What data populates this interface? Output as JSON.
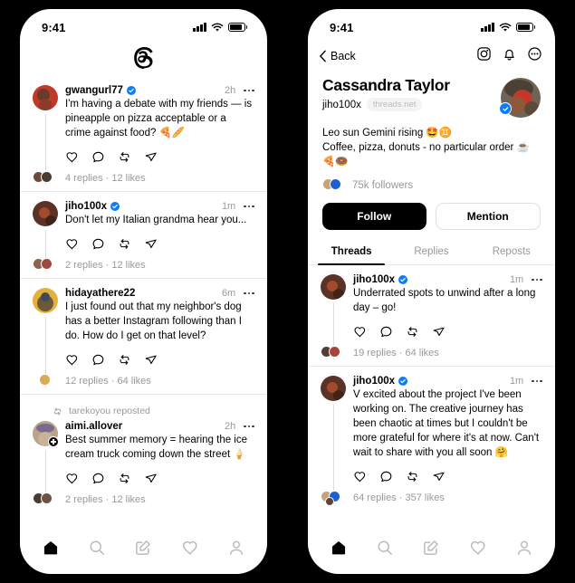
{
  "status_bar": {
    "time": "9:41",
    "signal_icon": "cellular-signal-icon",
    "wifi_icon": "wifi-icon",
    "battery_icon": "battery-icon"
  },
  "left_phone": {
    "app_logo": "threads-logo",
    "posts": [
      {
        "username": "gwangurl77",
        "verified": true,
        "time": "2h",
        "text": "I'm having a debate with my friends — is pineapple on pizza acceptable or a crime against food? 🍕🥖",
        "meta": "4 replies · 12 likes",
        "avatar_colors": [
          "#8d3a2a",
          "#c0392b"
        ],
        "facepile": [
          "#6b4a3a",
          "#4a3b33"
        ]
      },
      {
        "username": "jiho100x",
        "verified": true,
        "time": "1m",
        "text": "Don't let my Italian grandma hear you...",
        "meta": "2 replies · 12 likes",
        "avatar_colors": [
          "#5a3226",
          "#a34b2c"
        ],
        "facepile": [
          "#8a6652",
          "#9c4a3c"
        ]
      },
      {
        "username": "hidayathere22",
        "verified": false,
        "time": "6m",
        "text": "I just found out that my neighbor's dog has a better Instagram following than I do. How do I get on that level?",
        "meta": "12 replies · 64 likes",
        "avatar_colors": [
          "#e4b23c",
          "#6b5a3a"
        ],
        "facepile": [
          "#d9ab54"
        ]
      },
      {
        "repost_label": "tarekoyou reposted",
        "username": "aimi.allover",
        "verified": false,
        "time": "2h",
        "text": "Best summer memory = hearing the ice cream truck coming down the street 🍦",
        "meta": "2 replies · 12 likes",
        "avatar_colors": [
          "#7a6a8f",
          "#b8a38a"
        ],
        "facepile": [
          "#4b3a33",
          "#6d5347"
        ],
        "has_plus_badge": true
      }
    ],
    "nav": [
      {
        "name": "home-icon",
        "active": true
      },
      {
        "name": "search-icon",
        "active": false
      },
      {
        "name": "compose-icon",
        "active": false
      },
      {
        "name": "activity-heart-icon",
        "active": false
      },
      {
        "name": "profile-icon",
        "active": false
      }
    ]
  },
  "right_phone": {
    "back_label": "Back",
    "top_icons": [
      "instagram-icon",
      "bell-icon",
      "more-circle-icon"
    ],
    "profile": {
      "display_name": "Cassandra Taylor",
      "handle": "jiho100x",
      "network_pill": "threads.net",
      "bio_line1": "Leo sun Gemini rising 🤩♊",
      "bio_line2": "Coffee, pizza, donuts - no particular order ☕🍕🍩",
      "followers": "75k followers",
      "verified": true,
      "follow_button": "Follow",
      "mention_button": "Mention"
    },
    "tabs": [
      {
        "label": "Threads",
        "active": true
      },
      {
        "label": "Replies",
        "active": false
      },
      {
        "label": "Reposts",
        "active": false
      }
    ],
    "posts": [
      {
        "username": "jiho100x",
        "verified": true,
        "time": "1m",
        "text": "Underrated spots to unwind after a long day – go!",
        "meta": "19 replies · 64 likes",
        "avatar_colors": [
          "#5a3226",
          "#a34b2c"
        ],
        "facepile": [
          "#4e4038",
          "#a4453b"
        ]
      },
      {
        "username": "jiho100x",
        "verified": true,
        "time": "1m",
        "text": "V excited about the project I've been working on. The creative journey has been chaotic at times but I couldn't be more grateful for where it's at now. Can't wait to share with you all soon 🤗",
        "meta": "64 replies · 357 likes",
        "avatar_colors": [
          "#5a3226",
          "#a34b2c"
        ],
        "facepile": [
          "#c6a37a",
          "#1f5fd0",
          "#5a4438"
        ]
      }
    ],
    "nav": [
      {
        "name": "home-icon",
        "active": true
      },
      {
        "name": "search-icon",
        "active": false
      },
      {
        "name": "compose-icon",
        "active": false
      },
      {
        "name": "activity-heart-icon",
        "active": false
      },
      {
        "name": "profile-icon",
        "active": false
      }
    ]
  },
  "colors": {
    "verified_blue": "#0a7cff",
    "muted": "#999999",
    "divider": "#eaeaea",
    "background": "#000000"
  }
}
